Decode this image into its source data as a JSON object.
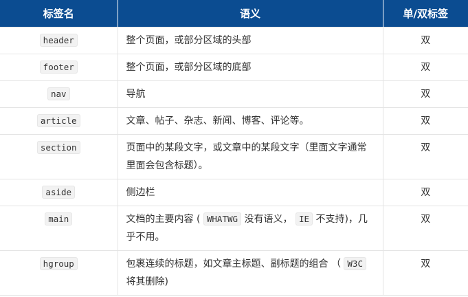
{
  "headers": [
    "标签名",
    "语义",
    "单/双标签"
  ],
  "rows": [
    {
      "tag": "header",
      "desc": [
        {
          "t": "整个页面，或部分区域的头部"
        }
      ],
      "type": "双"
    },
    {
      "tag": "footer",
      "desc": [
        {
          "t": "整个页面，或部分区域的底部"
        }
      ],
      "type": "双"
    },
    {
      "tag": "nav",
      "desc": [
        {
          "t": "导航"
        }
      ],
      "type": "双"
    },
    {
      "tag": "article",
      "desc": [
        {
          "t": "文章、帖子、杂志、新闻、博客、评论等。"
        }
      ],
      "type": "双"
    },
    {
      "tag": "section",
      "desc": [
        {
          "t": "页面中的某段文字，或文章中的某段文字（里面文字通常里面会包含标题）。"
        }
      ],
      "type": "双"
    },
    {
      "tag": "aside",
      "desc": [
        {
          "t": "侧边栏"
        }
      ],
      "type": "双"
    },
    {
      "tag": "main",
      "desc": [
        {
          "t": "文档的主要内容 ( "
        },
        {
          "t": "WHATWG",
          "code": true
        },
        {
          "t": " 没有语义， "
        },
        {
          "t": "IE",
          "code": true
        },
        {
          "t": " 不支持)，几乎不用。"
        }
      ],
      "type": "双"
    },
    {
      "tag": "hgroup",
      "desc": [
        {
          "t": "包裹连续的标题，如文章主标题、副标题的组合 （ "
        },
        {
          "t": "W3C",
          "code": true
        },
        {
          "t": " 将其删除)"
        }
      ],
      "type": "双"
    }
  ]
}
